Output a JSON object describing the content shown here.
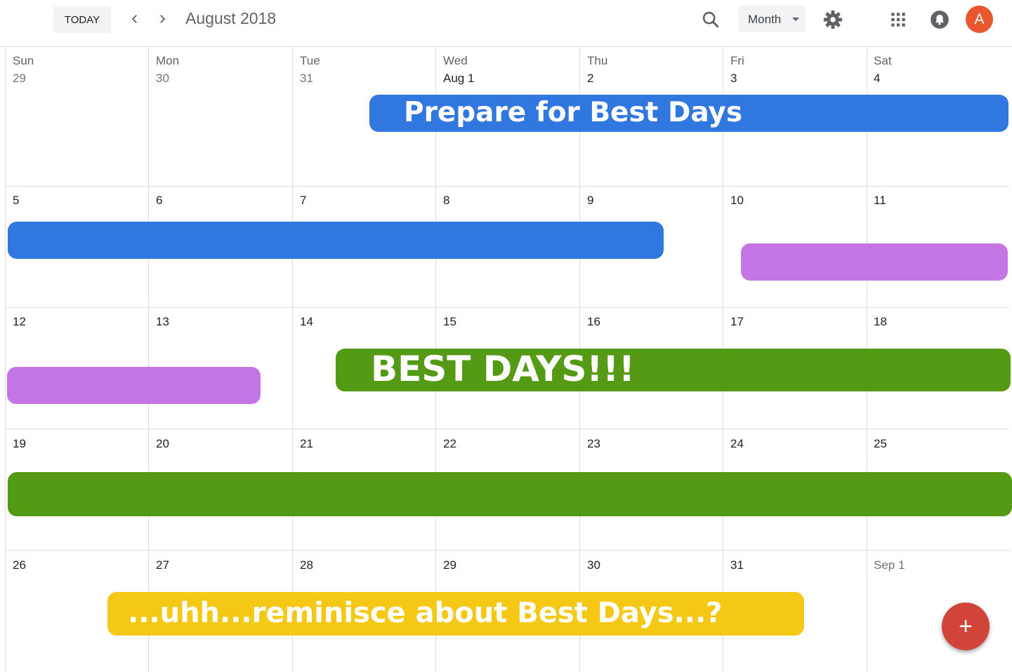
{
  "header": {
    "today_label": "TODAY",
    "title": "August 2018",
    "view_label": "Month",
    "avatar_initial": "A"
  },
  "icons": {
    "prev": "chevron-left-icon",
    "next": "chevron-right-icon",
    "search": "search-icon",
    "settings": "gear-icon",
    "apps": "apps-grid-icon",
    "notifications": "bell-icon",
    "fab": "plus-icon"
  },
  "calendar": {
    "weekdays": [
      "Sun",
      "Mon",
      "Tue",
      "Wed",
      "Thu",
      "Fri",
      "Sat"
    ],
    "weeks": [
      [
        "29",
        "30",
        "31",
        "Aug 1",
        "2",
        "3",
        "4"
      ],
      [
        "5",
        "6",
        "7",
        "8",
        "9",
        "10",
        "11"
      ],
      [
        "12",
        "13",
        "14",
        "15",
        "16",
        "17",
        "18"
      ],
      [
        "19",
        "20",
        "21",
        "22",
        "23",
        "24",
        "25"
      ],
      [
        "26",
        "27",
        "28",
        "29",
        "30",
        "31",
        "Sep 1"
      ]
    ]
  },
  "events": [
    {
      "title": "Prepare for Best Days",
      "color": "#3177e0"
    },
    {
      "title": "",
      "color": "#3177e0"
    },
    {
      "title": "",
      "color": "#c477e4"
    },
    {
      "title": "",
      "color": "#c477e4"
    },
    {
      "title": "BEST DAYS!!!",
      "color": "#549a15"
    },
    {
      "title": "",
      "color": "#549a15"
    },
    {
      "title": "...uhh...reminisce about Best Days...?",
      "color": "#f5c815"
    }
  ],
  "fab": {
    "label": "+"
  }
}
